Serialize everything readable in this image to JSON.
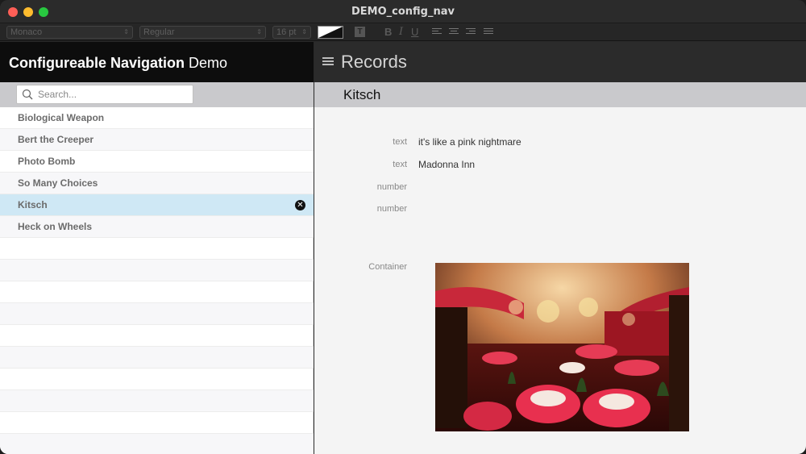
{
  "window": {
    "title": "DEMO_config_nav"
  },
  "format_bar": {
    "font": "Monaco",
    "style": "Regular",
    "size": "16 pt",
    "bold": "B",
    "italic": "I",
    "underline": "U",
    "text_color_icon": "T"
  },
  "left": {
    "title_bold": "Configureable Navigation",
    "title_light": "Demo",
    "search": {
      "placeholder": "Search...",
      "value": ""
    },
    "items": [
      {
        "label": "Biological Weapon"
      },
      {
        "label": "Bert the Creeper"
      },
      {
        "label": "Photo Bomb"
      },
      {
        "label": "So Many Choices"
      },
      {
        "label": "Kitsch",
        "selected": true
      },
      {
        "label": "Heck on Wheels"
      }
    ],
    "delete_symbol": "✕"
  },
  "right": {
    "title": "Records",
    "record_name": "Kitsch",
    "fields": [
      {
        "label": "text",
        "value": "it's like a pink nightmare"
      },
      {
        "label": "text",
        "value": "Madonna Inn"
      },
      {
        "label": "number",
        "value": ""
      },
      {
        "label": "number",
        "value": ""
      },
      {
        "label": "Container",
        "value": ""
      }
    ]
  },
  "colors": {
    "selected_row": "#cfe8f5",
    "header_dark": "#0d0d0d",
    "strip_gray": "#c9c9cc"
  }
}
